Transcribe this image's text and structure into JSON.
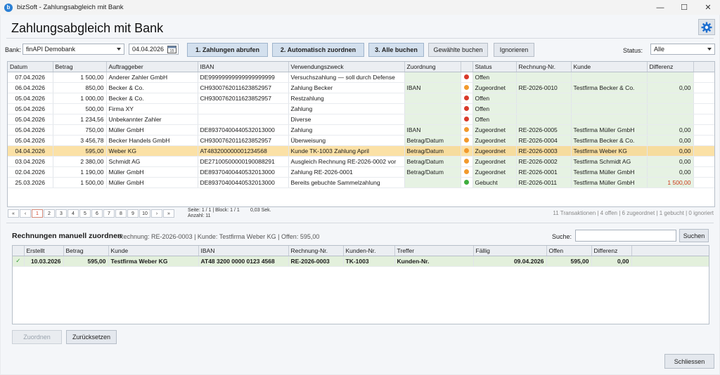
{
  "window": {
    "title": "bizSoft - Zahlungsabgleich mit Bank",
    "logo_letter": "b"
  },
  "header": {
    "title": "Zahlungsabgleich mit Bank"
  },
  "toolbar": {
    "bank_label": "Bank:",
    "bank_value": "finAPI Demobank",
    "date_value": "04.04.2026",
    "btn_fetch": "1. Zahlungen abrufen",
    "btn_auto": "2. Automatisch zuordnen",
    "btn_book_all": "3. Alle buchen",
    "btn_book_selected": "Gewählte buchen",
    "btn_ignore": "Ignorieren",
    "status_label": "Status:",
    "status_value": "Alle"
  },
  "transactions": {
    "columns": [
      "Datum",
      "Betrag",
      "Auftraggeber",
      "IBAN",
      "Verwendungszweck",
      "Zuordnung",
      "",
      "Status",
      "Rechnung-Nr.",
      "Kunde",
      "Differenz"
    ],
    "rows": [
      {
        "datum": "07.04.2026",
        "betrag": "1 500,00",
        "auftraggeber": "Anderer Zahler GmbH",
        "iban": "DE99999999999999999999",
        "zweck": "Versuchszahlung — soll durch Defense",
        "zuordnung": "",
        "status_color": "#d93a2b",
        "status": "Offen",
        "rechnung": "",
        "kunde": "",
        "differenz": ""
      },
      {
        "datum": "06.04.2026",
        "betrag": "850,00",
        "auftraggeber": "Becker & Co.",
        "iban": "CH9300762011623852957",
        "zweck": "Zahlung Becker",
        "zuordnung": "IBAN",
        "status_color": "#f29a2e",
        "status": "Zugeordnet",
        "rechnung": "RE-2026-0010",
        "kunde": "Testfirma Becker & Co.",
        "differenz": "0,00"
      },
      {
        "datum": "05.04.2026",
        "betrag": "1 000,00",
        "auftraggeber": "Becker & Co.",
        "iban": "CH9300762011623852957",
        "zweck": "Restzahlung",
        "zuordnung": "",
        "status_color": "#d93a2b",
        "status": "Offen",
        "rechnung": "",
        "kunde": "",
        "differenz": ""
      },
      {
        "datum": "05.04.2026",
        "betrag": "500,00",
        "auftraggeber": "Firma XY",
        "iban": "",
        "zweck": "Zahlung",
        "zuordnung": "",
        "status_color": "#d93a2b",
        "status": "Offen",
        "rechnung": "",
        "kunde": "",
        "differenz": ""
      },
      {
        "datum": "05.04.2026",
        "betrag": "1 234,56",
        "auftraggeber": "Unbekannter Zahler",
        "iban": "",
        "zweck": "Diverse",
        "zuordnung": "",
        "status_color": "#d93a2b",
        "status": "Offen",
        "rechnung": "",
        "kunde": "",
        "differenz": ""
      },
      {
        "datum": "05.04.2026",
        "betrag": "750,00",
        "auftraggeber": "Müller GmbH",
        "iban": "DE89370400440532013000",
        "zweck": "Zahlung",
        "zuordnung": "IBAN",
        "status_color": "#f29a2e",
        "status": "Zugeordnet",
        "rechnung": "RE-2026-0005",
        "kunde": "Testfirma Müller GmbH",
        "differenz": "0,00"
      },
      {
        "datum": "05.04.2026",
        "betrag": "3 456,78",
        "auftraggeber": "Becker Handels GmbH",
        "iban": "CH9300762011623852957",
        "zweck": "Überweisung",
        "zuordnung": "Betrag/Datum",
        "status_color": "#f29a2e",
        "status": "Zugeordnet",
        "rechnung": "RE-2026-0004",
        "kunde": "Testfirma Becker & Co.",
        "differenz": "0,00"
      },
      {
        "datum": "04.04.2026",
        "betrag": "595,00",
        "auftraggeber": "Weber KG",
        "iban": "AT483200000001234568",
        "zweck": "Kunde TK-1003 Zahlung April",
        "zuordnung": "Betrag/Datum",
        "status_color": "#f29a2e",
        "status": "Zugeordnet",
        "rechnung": "RE-2026-0003",
        "kunde": "Testfirma Weber KG",
        "differenz": "0,00",
        "selected": true
      },
      {
        "datum": "03.04.2026",
        "betrag": "2 380,00",
        "auftraggeber": "Schmidt AG",
        "iban": "DE27100500000190088291",
        "zweck": "Ausgleich Rechnung RE-2026-0002 vor",
        "zuordnung": "Betrag/Datum",
        "status_color": "#f29a2e",
        "status": "Zugeordnet",
        "rechnung": "RE-2026-0002",
        "kunde": "Testfirma Schmidt AG",
        "differenz": "0,00"
      },
      {
        "datum": "02.04.2026",
        "betrag": "1 190,00",
        "auftraggeber": "Müller GmbH",
        "iban": "DE89370400440532013000",
        "zweck": "Zahlung RE-2026-0001",
        "zuordnung": "Betrag/Datum",
        "status_color": "#f29a2e",
        "status": "Zugeordnet",
        "rechnung": "RE-2026-0001",
        "kunde": "Testfirma Müller GmbH",
        "differenz": "0,00"
      },
      {
        "datum": "25.03.2026",
        "betrag": "1 500,00",
        "auftraggeber": "Müller GmbH",
        "iban": "DE89370400440532013000",
        "zweck": "Bereits gebuchte Sammelzahlung",
        "zuordnung": "",
        "status_color": "#3fae3f",
        "status": "Gebucht",
        "rechnung": "RE-2026-0011",
        "kunde": "Testfirma Müller GmbH",
        "differenz": "1 500,00",
        "diff_red": true
      }
    ]
  },
  "pager": {
    "buttons": [
      "«",
      "‹",
      "1",
      "2",
      "3",
      "4",
      "5",
      "6",
      "7",
      "8",
      "9",
      "10",
      "›",
      "»"
    ],
    "active": "1",
    "page_info": "Seite: 1 / 1 | Block: 1 / 1",
    "count_info": "Anzahl: 11",
    "time_info": "0,03 Sek.",
    "summary": "11 Transaktionen | 4 offen | 6 zugeordnet | 1 gebucht | 0 ignoriert"
  },
  "manual": {
    "title": "Rechnungen manuell zuordnen",
    "info": "Rechnung: RE-2026-0003 | Kunde: Testfirma Weber KG | Offen: 595,00",
    "search_label": "Suche:",
    "search_value": "",
    "search_btn": "Suchen",
    "columns": [
      "",
      "Erstellt",
      "Betrag",
      "Kunde",
      "IBAN",
      "Rechnung-Nr.",
      "Kunden-Nr.",
      "Treffer",
      "Fällig",
      "Offen",
      "Differenz"
    ],
    "rows": [
      {
        "check": "✓",
        "erstellt": "10.03.2026",
        "betrag": "595,00",
        "kunde": "Testfirma Weber KG",
        "iban": "AT48 3200 0000 0123 4568",
        "rechnung": "RE-2026-0003",
        "kundennr": "TK-1003",
        "treffer": "Kunden-Nr.",
        "faellig": "09.04.2026",
        "offen": "595,00",
        "differenz": "0,00"
      }
    ],
    "btn_assign": "Zuordnen",
    "btn_reset": "Zurücksetzen"
  },
  "footer": {
    "btn_close": "Schliessen"
  }
}
